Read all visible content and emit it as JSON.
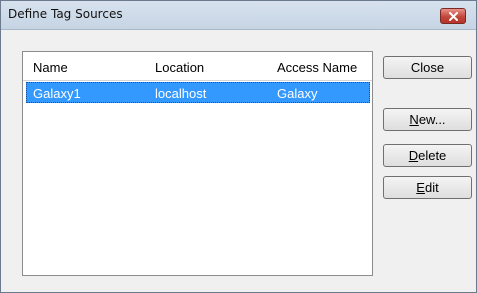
{
  "window": {
    "title": "Define Tag Sources"
  },
  "list": {
    "columns": [
      "Name",
      "Location",
      "Access Name"
    ],
    "rows": [
      {
        "name": "Galaxy1",
        "location": "localhost",
        "access_name": "Galaxy",
        "selected": true
      }
    ]
  },
  "buttons": {
    "close": "Close",
    "new": {
      "mnemonic": "N",
      "rest": "ew..."
    },
    "delete": {
      "mnemonic": "D",
      "rest": "elete"
    },
    "edit": {
      "mnemonic": "E",
      "rest": "dit"
    }
  },
  "icons": {
    "title_close": "close-icon"
  },
  "colors": {
    "selection": "#3399ff",
    "title_close": "#c2473b"
  }
}
